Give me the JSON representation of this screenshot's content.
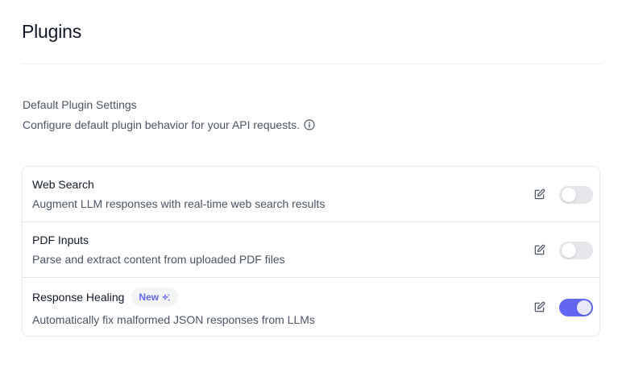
{
  "page": {
    "title": "Plugins"
  },
  "section": {
    "heading": "Default Plugin Settings",
    "description": "Configure default plugin behavior for your API requests."
  },
  "plugins": [
    {
      "name": "Web Search",
      "description": "Augment LLM responses with real-time web search results",
      "enabled": false,
      "badge": ""
    },
    {
      "name": "PDF Inputs",
      "description": "Parse and extract content from uploaded PDF files",
      "enabled": false,
      "badge": ""
    },
    {
      "name": "Response Healing",
      "description": "Automatically fix malformed JSON responses from LLMs",
      "enabled": true,
      "badge": "New"
    }
  ],
  "icons": {
    "info": "info-icon",
    "edit": "pencil-edit-icon",
    "sparkle": "sparkle-icon"
  },
  "colors": {
    "accent": "#6366f1",
    "toggle_off": "#e5e7eb",
    "text_primary": "#111827",
    "text_secondary": "#4b5563",
    "border": "#e5e7eb"
  }
}
